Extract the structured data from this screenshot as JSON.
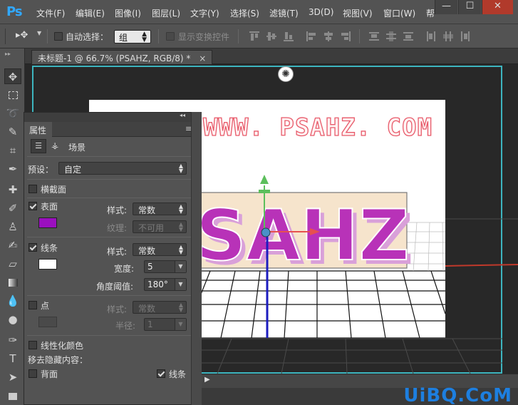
{
  "app": {
    "logo": "Ps"
  },
  "menu": [
    "文件(F)",
    "编辑(E)",
    "图像(I)",
    "图层(L)",
    "文字(Y)",
    "选择(S)",
    "滤镜(T)",
    "3D(D)",
    "视图(V)",
    "窗口(W)",
    "帮"
  ],
  "window_controls": {
    "min": "—",
    "max": "☐",
    "close": "✕"
  },
  "options": {
    "tool_glyph": "▸✥",
    "auto_select_label": "自动选择：",
    "auto_select_value": "组",
    "show_transform_label": "显示变换控件"
  },
  "document": {
    "tab_title": "未标题-1 @ 66.7% (PSAHZ, RGB/8) *",
    "close": "×",
    "canvas_text_top": "WWW. PSAHZ. COM",
    "canvas_text_3d": "SAHZ"
  },
  "panel": {
    "tab": "属性",
    "collapse": "◂◂",
    "close": "✕",
    "menu": "≡",
    "scene_label": "场景",
    "preset_label": "预设：",
    "preset_value": "自定",
    "cross_section": "横截面",
    "surface": {
      "label": "表面",
      "checked": true,
      "color": "#9b0fbf",
      "style_label": "样式:",
      "style_value": "常数",
      "texture_label": "纹理:",
      "texture_value": "不可用"
    },
    "lines": {
      "label": "线条",
      "checked": true,
      "color": "#ffffff",
      "style_label": "样式:",
      "style_value": "常数",
      "width_label": "宽度:",
      "width_value": "5",
      "angle_label": "角度阈值:",
      "angle_value": "180°"
    },
    "points": {
      "label": "点",
      "checked": false,
      "style_label": "样式:",
      "style_value": "常数",
      "radius_label": "半径:",
      "radius_value": "1"
    },
    "linearize": "线性化颜色",
    "remove_hidden": "移去隐藏内容：",
    "backface": "背面",
    "lines_check": "线条"
  },
  "watermark": "UiBQ.CoM",
  "colors": {
    "accent_teal": "#3db5bf",
    "text_purple": "#b832b8",
    "logo_blue": "#31a8ff"
  }
}
